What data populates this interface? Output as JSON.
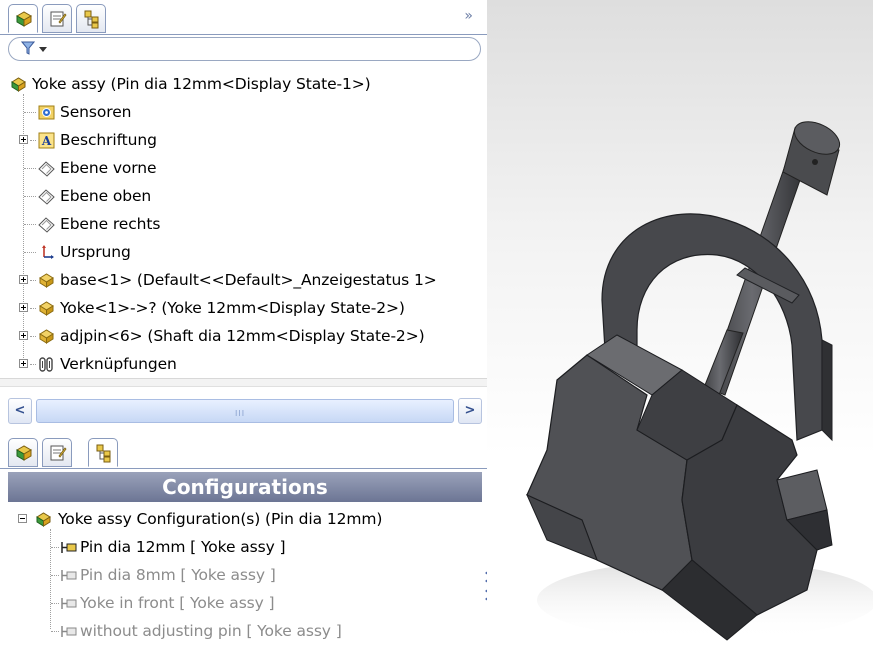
{
  "tabs_top": [
    {
      "name": "feature-manager",
      "active": true
    },
    {
      "name": "property-manager",
      "active": false
    },
    {
      "name": "configuration-manager",
      "active": false
    }
  ],
  "expand_glyph": "»",
  "filter": {
    "icon": "filter-funnel-icon"
  },
  "tree": {
    "root": "Yoke assy  (Pin dia 12mm<Display State-1>)",
    "items": [
      {
        "label": "Sensoren",
        "icon": "sensor-folder-icon",
        "expander": "none"
      },
      {
        "label": "Beschriftung",
        "icon": "annotations-icon",
        "expander": "collapsed"
      },
      {
        "label": "Ebene vorne",
        "icon": "plane-icon",
        "expander": "none"
      },
      {
        "label": "Ebene oben",
        "icon": "plane-icon",
        "expander": "none"
      },
      {
        "label": "Ebene rechts",
        "icon": "plane-icon",
        "expander": "none"
      },
      {
        "label": "Ursprung",
        "icon": "origin-icon",
        "expander": "none"
      },
      {
        "label": "base<1> (Default<<Default>_Anzeigestatus 1>",
        "icon": "component-icon",
        "expander": "collapsed"
      },
      {
        "label": "Yoke<1>->? (Yoke 12mm<Display State-2>)",
        "icon": "component-icon",
        "expander": "collapsed"
      },
      {
        "label": "adjpin<6> (Shaft dia 12mm<Display State-2>)",
        "icon": "component-icon",
        "expander": "collapsed"
      },
      {
        "label": "Verknüpfungen",
        "icon": "mates-icon",
        "expander": "collapsed"
      }
    ]
  },
  "scrollbar": {
    "left": "<",
    "right": ">",
    "grip": "III"
  },
  "tabs_bottom": [
    {
      "name": "feature-manager",
      "active": false
    },
    {
      "name": "property-manager",
      "active": false
    },
    {
      "name": "configuration-manager",
      "active": true
    }
  ],
  "configurations": {
    "header": "Configurations",
    "root": "Yoke assy Configuration(s)  (Pin dia 12mm)",
    "items": [
      {
        "label": "Pin dia 12mm [ Yoke assy ]",
        "active": true
      },
      {
        "label": "Pin dia 8mm [ Yoke assy ]",
        "active": false
      },
      {
        "label": "Yoke in front [ Yoke assy ]",
        "active": false
      },
      {
        "label": "without adjusting pin [ Yoke assy ]",
        "active": false
      }
    ]
  },
  "colors": {
    "accent_blue": "#6c7ea6",
    "config_header": "#7d85a0",
    "component_yellow": "#e9c84a",
    "component_green": "#3c9a3c",
    "model_grey": "#4a4b4e"
  }
}
